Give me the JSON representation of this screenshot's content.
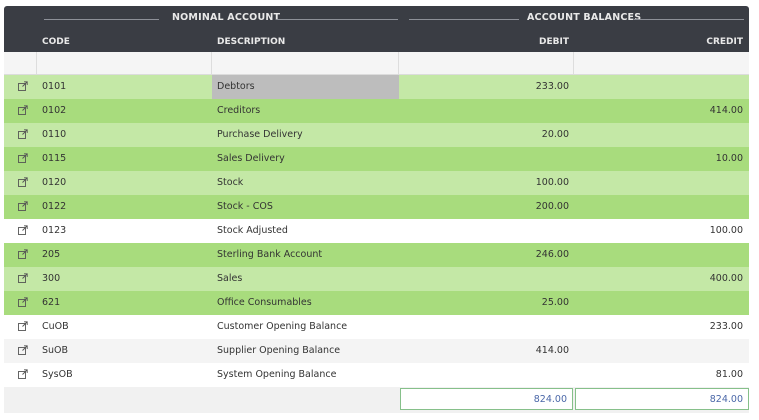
{
  "header": {
    "group_nominal": "NOMINAL ACCOUNT",
    "group_balances": "ACCOUNT BALANCES",
    "col_code": "CODE",
    "col_description": "DESCRIPTION",
    "col_debit": "DEBIT",
    "col_credit": "CREDIT"
  },
  "rows": [
    {
      "code": "0101",
      "description": "Debtors",
      "debit": "233.00",
      "credit": "",
      "bg": "#c4e8a6",
      "selected": true
    },
    {
      "code": "0102",
      "description": "Creditors",
      "debit": "",
      "credit": "414.00",
      "bg": "#a8dc7d"
    },
    {
      "code": "0110",
      "description": "Purchase Delivery",
      "debit": "20.00",
      "credit": "",
      "bg": "#c4e8a6"
    },
    {
      "code": "0115",
      "description": "Sales Delivery",
      "debit": "",
      "credit": "10.00",
      "bg": "#a8dc7d"
    },
    {
      "code": "0120",
      "description": "Stock",
      "debit": "100.00",
      "credit": "",
      "bg": "#c4e8a6"
    },
    {
      "code": "0122",
      "description": "Stock - COS",
      "debit": "200.00",
      "credit": "",
      "bg": "#a8dc7d"
    },
    {
      "code": "0123",
      "description": "Stock Adjusted",
      "debit": "",
      "credit": "100.00",
      "bg": "#ffffff"
    },
    {
      "code": "205",
      "description": "Sterling Bank Account",
      "debit": "246.00",
      "credit": "",
      "bg": "#a8dc7d"
    },
    {
      "code": "300",
      "description": "Sales",
      "debit": "",
      "credit": "400.00",
      "bg": "#c4e8a6"
    },
    {
      "code": "621",
      "description": "Office Consumables",
      "debit": "25.00",
      "credit": "",
      "bg": "#a8dc7d"
    },
    {
      "code": "CuOB",
      "description": "Customer Opening Balance",
      "debit": "",
      "credit": "233.00",
      "bg": "#ffffff"
    },
    {
      "code": "SuOB",
      "description": "Supplier Opening Balance",
      "debit": "414.00",
      "credit": "",
      "bg": "#f4f4f4"
    },
    {
      "code": "SysOB",
      "description": "System Opening Balance",
      "debit": "",
      "credit": "81.00",
      "bg": "#ffffff"
    }
  ],
  "totals": {
    "debit": "824.00",
    "credit": "824.00"
  },
  "colors": {
    "header_bg": "#3a3d44",
    "accent_green": "#a8dc7d",
    "light_green": "#c4e8a6",
    "total_text": "#4a67a8",
    "selected_cell": "#bdbdbd"
  },
  "icons": {
    "row_action": "external-link-icon"
  }
}
